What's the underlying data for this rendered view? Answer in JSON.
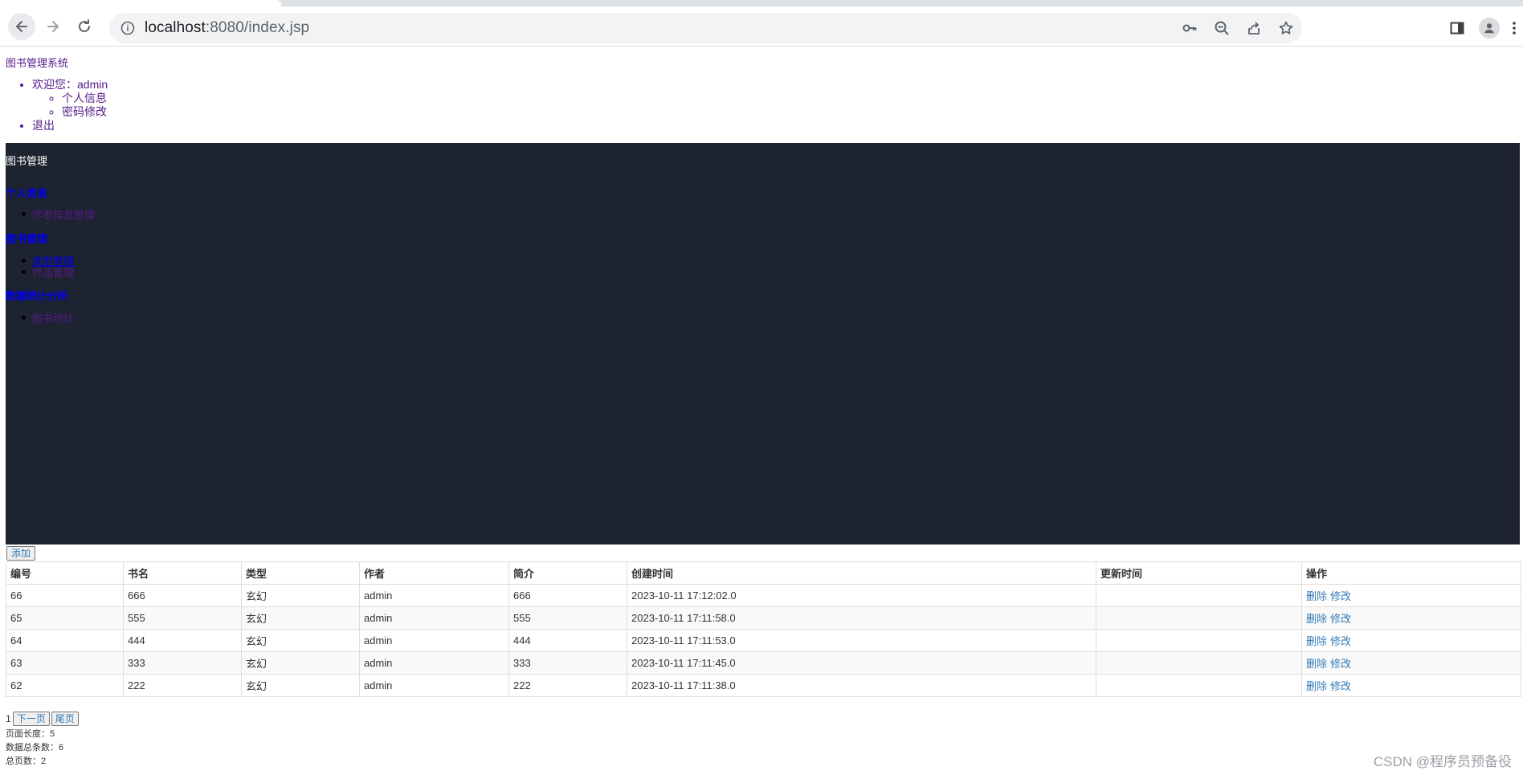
{
  "browser": {
    "url_host": "localhost",
    "url_path": ":8080/index.jsp"
  },
  "header": {
    "brand": "图书管理系统",
    "user_welcome": "欢迎您：admin",
    "user_menu": [
      "个人信息",
      "密码修改"
    ],
    "logout": "退出"
  },
  "sidebar": {
    "title": "图书管理",
    "groups": [
      {
        "label": "个人信息",
        "items": [
          "作者信息管理"
        ]
      },
      {
        "label": "图书管理",
        "items": [
          "类型管理",
          "作品管理"
        ]
      },
      {
        "label": "数据统计分析",
        "items": [
          "图书统计"
        ]
      }
    ]
  },
  "toolbar": {
    "add_label": "添加"
  },
  "table": {
    "columns": [
      "编号",
      "书名",
      "类型",
      "作者",
      "简介",
      "创建时间",
      "更新时间",
      "操作"
    ],
    "rows": [
      {
        "id": "66",
        "name": "666",
        "type": "玄幻",
        "author": "admin",
        "intro": "666",
        "created": "2023-10-11 17:12:02.0",
        "updated": ""
      },
      {
        "id": "65",
        "name": "555",
        "type": "玄幻",
        "author": "admin",
        "intro": "555",
        "created": "2023-10-11 17:11:58.0",
        "updated": ""
      },
      {
        "id": "64",
        "name": "444",
        "type": "玄幻",
        "author": "admin",
        "intro": "444",
        "created": "2023-10-11 17:11:53.0",
        "updated": ""
      },
      {
        "id": "63",
        "name": "333",
        "type": "玄幻",
        "author": "admin",
        "intro": "333",
        "created": "2023-10-11 17:11:45.0",
        "updated": ""
      },
      {
        "id": "62",
        "name": "222",
        "type": "玄幻",
        "author": "admin",
        "intro": "222",
        "created": "2023-10-11 17:11:38.0",
        "updated": ""
      }
    ],
    "action_delete": "删除",
    "action_edit": "修改"
  },
  "pager": {
    "current_page": "1",
    "next_label": "下一页",
    "last_label": "尾页",
    "page_size_text": "页面长度：5",
    "total_rows_text": "数据总条数：6",
    "total_pages_text": "总页数：2"
  },
  "watermark": "CSDN @程序员预备役"
}
